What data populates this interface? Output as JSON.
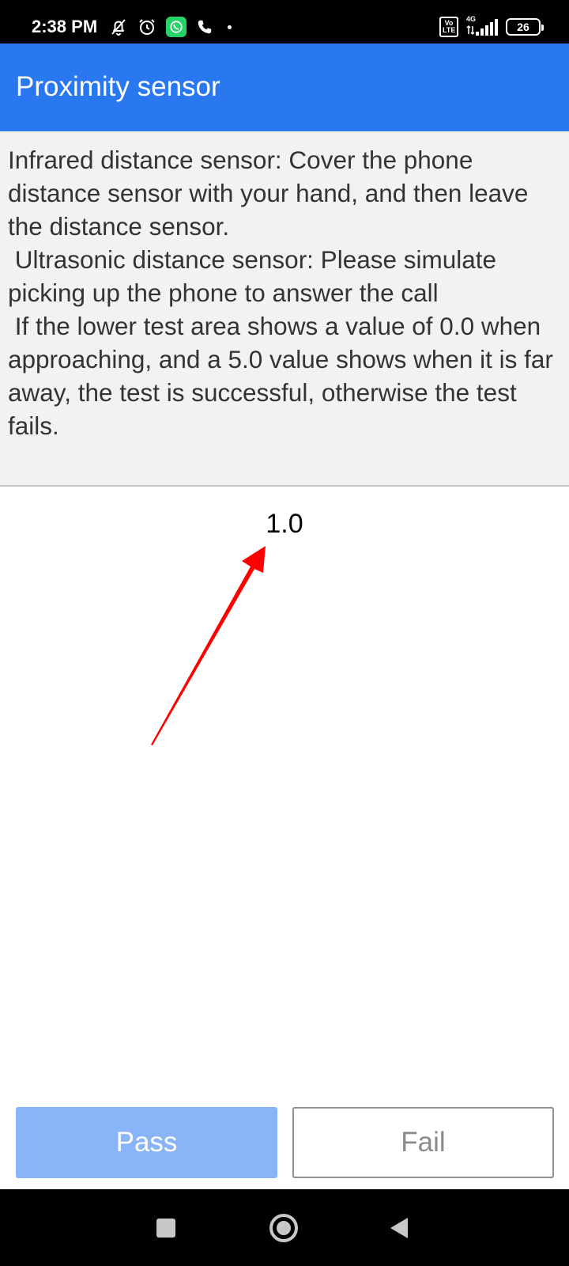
{
  "status_bar": {
    "time": "2:38 PM",
    "icons_left": [
      "bell-off-icon",
      "alarm-icon",
      "whatsapp-icon",
      "phone-icon",
      "dot-icon"
    ],
    "volte": "Vo LTE",
    "network": "4G",
    "battery": "26"
  },
  "app_bar": {
    "title": "Proximity sensor",
    "color": "#2a78f0"
  },
  "instructions": {
    "text": "Infrared distance sensor: Cover the phone distance sensor with your hand, and then leave the distance sensor.\n Ultrasonic distance sensor: Please simulate picking up the phone to answer the call\n If the lower test area shows a value of 0.0 when approaching, and a 5.0 value shows when it is far away, the test is successful, otherwise the test fails."
  },
  "reading": {
    "value": "1.0"
  },
  "annotation": {
    "arrow_color": "#ff0000"
  },
  "buttons": {
    "pass_label": "Pass",
    "fail_label": "Fail",
    "pass_color": "#8ab4f8"
  },
  "nav_bar": {
    "icons": [
      "recents-icon",
      "home-icon",
      "back-icon"
    ]
  }
}
